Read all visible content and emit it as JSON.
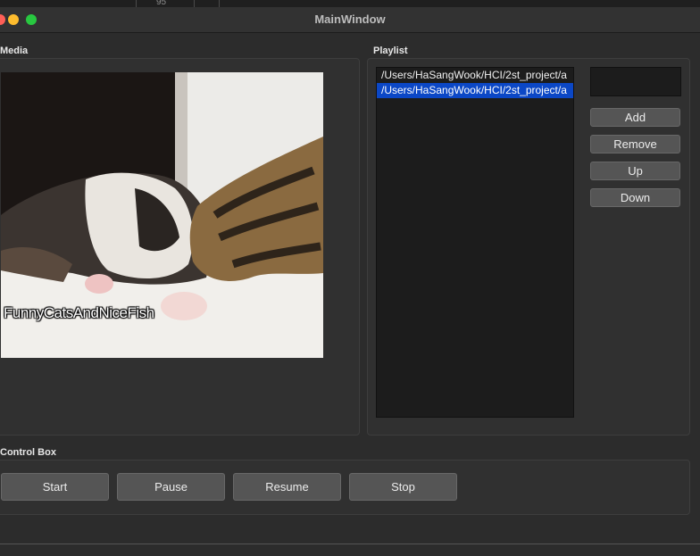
{
  "background_strip": {
    "number": "95"
  },
  "window": {
    "title": "MainWindow"
  },
  "media": {
    "group_label": "Media",
    "watermark": "FunnyCatsAndNiceFish"
  },
  "playlist": {
    "group_label": "Playlist",
    "items": [
      {
        "text": "/Users/HaSangWook/HCI/2st_project/a",
        "selected": false
      },
      {
        "text": "/Users/HaSangWook/HCI/2st_project/a",
        "selected": true
      }
    ],
    "text_field_value": "",
    "buttons": {
      "add": "Add",
      "remove": "Remove",
      "up": "Up",
      "down": "Down"
    }
  },
  "control_box": {
    "group_label": "Control Box",
    "buttons": {
      "start": "Start",
      "pause": "Pause",
      "resume": "Resume",
      "stop": "Stop"
    }
  },
  "colors": {
    "window_bg": "#2c2c2c",
    "selection": "#0b47c6",
    "close": "#ff5f57",
    "minimize": "#febc2e",
    "zoom": "#28c840"
  }
}
